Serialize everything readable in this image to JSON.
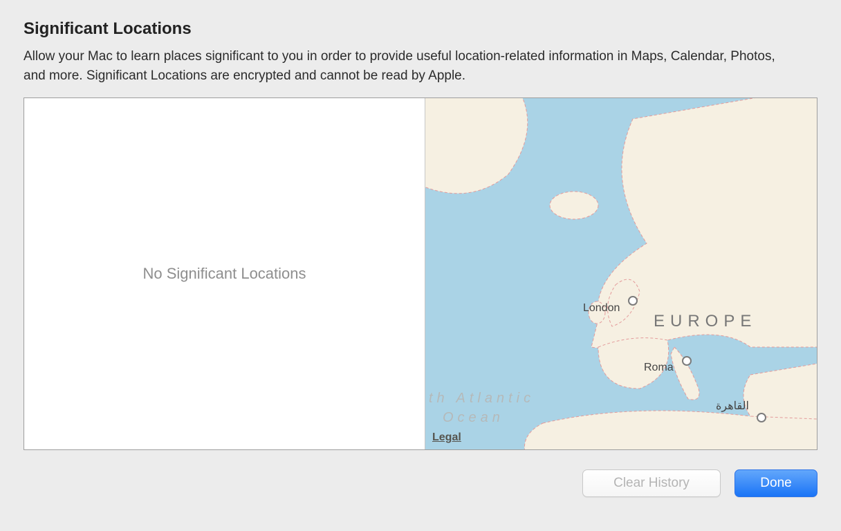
{
  "title": "Significant Locations",
  "description": "Allow your Mac to learn places significant to you in order to provide useful location-related information in Maps, Calendar, Photos, and more. Significant Locations are encrypted and cannot be read by Apple.",
  "empty_state": "No Significant Locations",
  "map": {
    "legal_link": "Legal",
    "ocean_label_line1": "th Atlantic",
    "ocean_label_line2": "Ocean",
    "continent_label": "EUROPE",
    "cities": {
      "london": "London",
      "roma": "Roma",
      "cairo": "القاهرة"
    }
  },
  "buttons": {
    "clear_history": "Clear History",
    "done": "Done"
  }
}
